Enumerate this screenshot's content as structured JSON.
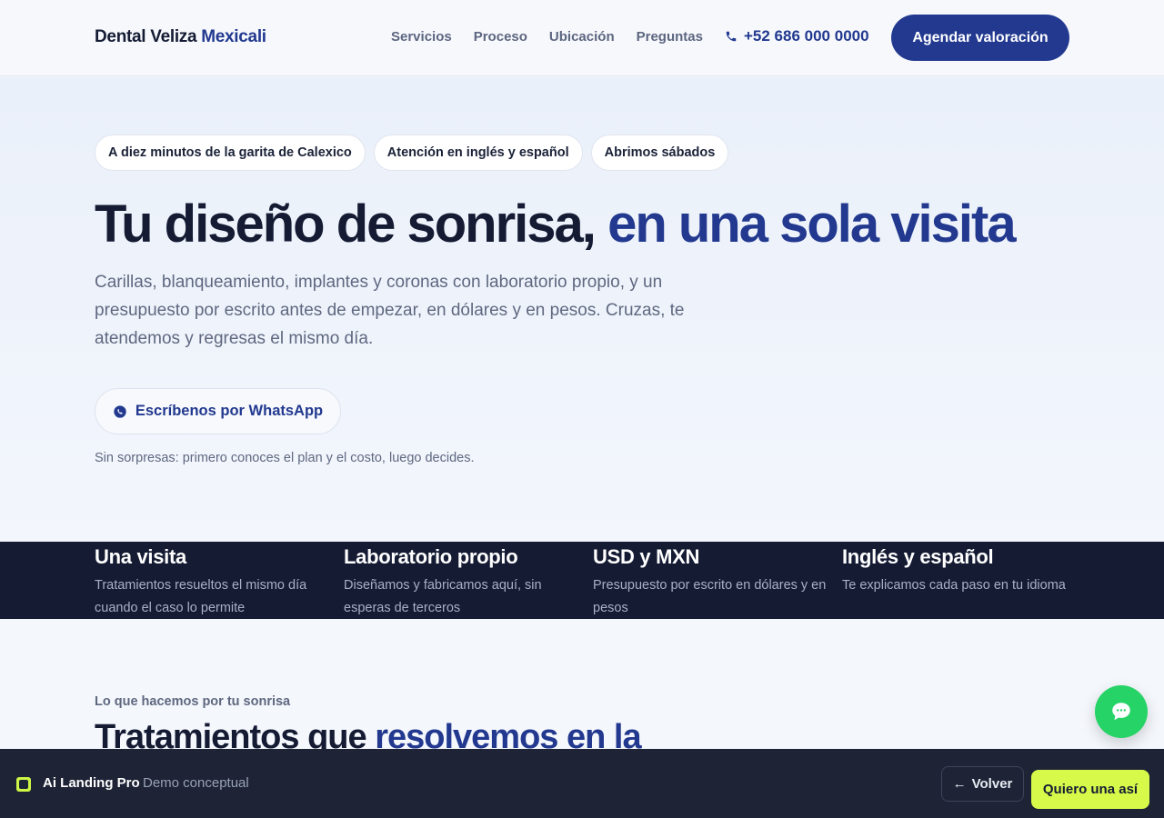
{
  "brand": {
    "name": "Dental Veliza",
    "accent": "Mexicali"
  },
  "nav": {
    "items": [
      {
        "label": "Servicios"
      },
      {
        "label": "Proceso"
      },
      {
        "label": "Ubicación"
      },
      {
        "label": "Preguntas"
      }
    ],
    "phone": "+52 686 000 0000",
    "cta": "Agendar valoración"
  },
  "hero": {
    "chips": [
      "A diez minutos de la garita de Calexico",
      "Atención en inglés y español",
      "Abrimos sábados"
    ],
    "title_main": "Tu diseño de sonrisa,",
    "title_accent": "en una sola visita",
    "subtitle": "Carillas, blanqueamiento, implantes y coronas con laboratorio propio, y un presupuesto por escrito antes de empezar, en dólares y en pesos. Cruzas, te atendemos y regresas el mismo día.",
    "whatsapp_button": "Escríbenos por WhatsApp",
    "note": "Sin sorpresas: primero conoces el plan y el costo, luego decides."
  },
  "features": [
    {
      "title": "Una visita",
      "desc": "Tratamientos resueltos el mismo día cuando el caso lo permite"
    },
    {
      "title": "Laboratorio propio",
      "desc": "Diseñamos y fabricamos aquí, sin esperas de terceros"
    },
    {
      "title": "USD y MXN",
      "desc": "Presupuesto por escrito en dólares y en pesos"
    },
    {
      "title": "Inglés y español",
      "desc": "Te explicamos cada paso en tu idioma"
    }
  ],
  "services": {
    "eyebrow": "Lo que hacemos por tu sonrisa",
    "title_main": "Tratamientos que",
    "title_accent": "resolvemos en la"
  },
  "demo_bar": {
    "name": "Ai Landing Pro",
    "tag": "Demo conceptual",
    "back": "Volver",
    "want": "Quiero una así"
  },
  "icons": {
    "phone": "phone-icon",
    "whatsapp": "whatsapp-icon",
    "chat": "chat-icon",
    "back": "arrow-left-icon",
    "logo": "logo-icon"
  },
  "colors": {
    "primary": "#22398f",
    "dark": "#141b33",
    "whatsapp": "#25d366",
    "lime": "#d7fa4a",
    "demo_bar": "#1e2436"
  }
}
